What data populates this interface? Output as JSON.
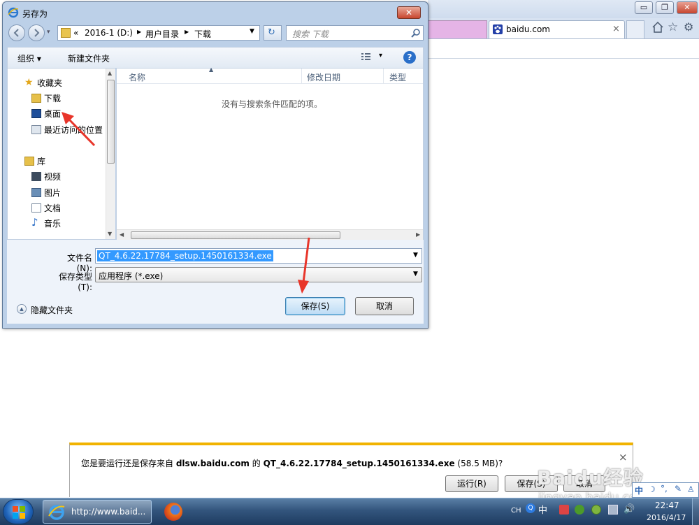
{
  "browser": {
    "tab_label": "baidu.com",
    "tab_close": "×",
    "window_buttons": [
      "▭",
      "❐",
      "✕"
    ],
    "toolbar_icons": [
      "home-icon",
      "star-icon",
      "gear-icon"
    ]
  },
  "dialog": {
    "title": "另存为",
    "close_label": "✕",
    "path": {
      "prefix": "«",
      "segments": [
        "2016-1 (D:)",
        "用户目录",
        "下载"
      ]
    },
    "search_placeholder": "搜索 下载",
    "toolbar": {
      "organize": "组织 ▾",
      "new_folder": "新建文件夹",
      "view_dropdown": "▾",
      "help": "?"
    },
    "nav": {
      "favorites": "收藏夹",
      "favorites_items": [
        "下载",
        "桌面",
        "最近访问的位置"
      ],
      "library": "库",
      "library_items": [
        "视频",
        "图片",
        "文档",
        "音乐"
      ]
    },
    "columns": {
      "name": "名称",
      "modified": "修改日期",
      "type": "类型"
    },
    "empty_message": "没有与搜索条件匹配的项。",
    "filename_label": "文件名(N):",
    "filename_value": "QT_4.6.22.17784_setup.1450161334.exe",
    "filetype_label": "保存类型(T):",
    "filetype_value": "应用程序 (*.exe)",
    "hide_folders": "隐藏文件夹",
    "save_button": "保存(S)",
    "cancel_button": "取消"
  },
  "notification": {
    "text_prefix": "您是要运行还是保存来自",
    "domain": "dlsw.baidu.com",
    "text_mid": "的",
    "filename": "QT_4.6.22.17784_setup.1450161334.exe",
    "size": "(58.5 MB)?",
    "run_button": "运行(R)",
    "save_button": "保存(S)",
    "cancel_button": "取消",
    "close": "×"
  },
  "taskbar": {
    "ie_task_label": "http://www.baid...",
    "lang": "CH",
    "ime": "中",
    "time": "22:47",
    "date": "2016/4/17"
  },
  "watermark": {
    "brand": "Baidu经验",
    "url": "jingyan.baidu.com"
  },
  "colors": {
    "dialog_chrome": "#bcd0e8",
    "selection": "#3399ff",
    "annotation_arrow": "#e8352a",
    "notify_accent": "#f1b300"
  }
}
